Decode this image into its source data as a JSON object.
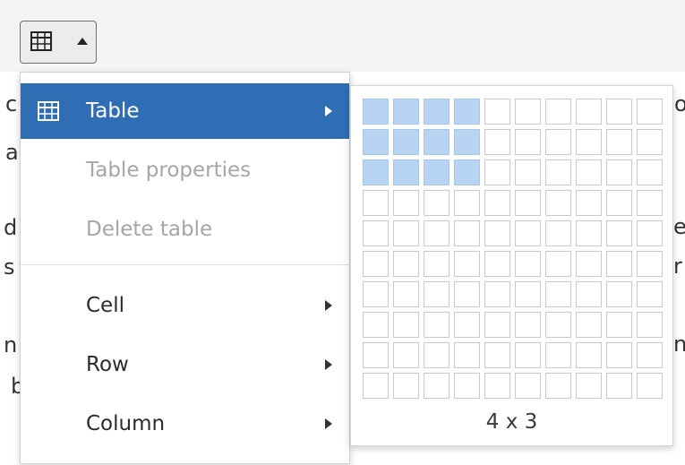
{
  "toolbar": {
    "table_button_icon": "table-grid-icon",
    "caret_icon": "caret-up-icon"
  },
  "background_text": [
    "c",
    "a",
    "d",
    "s",
    "n",
    "b",
    "o",
    "e",
    "r",
    "n"
  ],
  "menu": {
    "items": [
      {
        "label": "Table",
        "icon": "table-grid-icon",
        "has_submenu": true,
        "state": "active"
      },
      {
        "label": "Table properties",
        "state": "disabled"
      },
      {
        "label": "Delete table",
        "state": "disabled"
      },
      {
        "label": "Cell",
        "has_submenu": true,
        "state": "normal"
      },
      {
        "label": "Row",
        "has_submenu": true,
        "state": "normal"
      },
      {
        "label": "Column",
        "has_submenu": true,
        "state": "normal"
      }
    ]
  },
  "grid_picker": {
    "columns": 10,
    "rows": 10,
    "selected_columns": 4,
    "selected_rows": 3,
    "size_label": "4 x 3"
  },
  "colors": {
    "active_item": "#2f6eb5",
    "selected_cell": "#b8d4f3",
    "disabled_text": "#a6a6a6"
  }
}
